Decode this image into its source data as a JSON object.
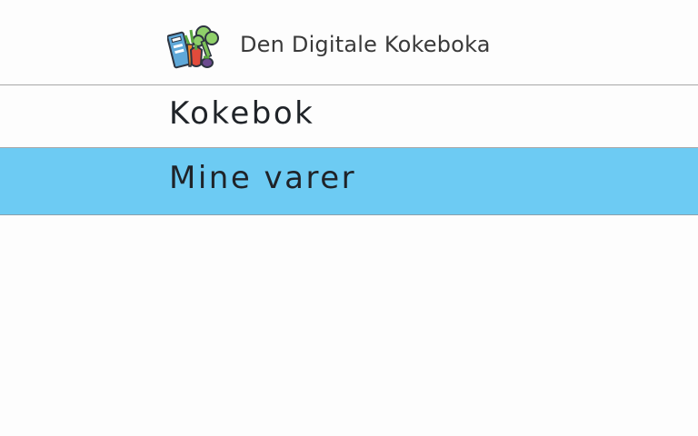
{
  "header": {
    "title": "Den Digitale Kokeboka",
    "logo_icon": "cookbook-vegetables-icon"
  },
  "nav": {
    "items": [
      {
        "label": "Kokebok",
        "active": false
      },
      {
        "label": "Mine varer",
        "active": true
      }
    ]
  },
  "colors": {
    "active_background": "#6dcbf3",
    "background": "#fdfdfd",
    "divider": "#a8a8a8"
  }
}
